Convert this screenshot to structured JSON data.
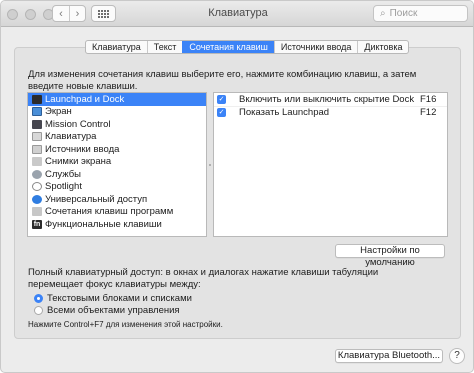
{
  "window": {
    "title": "Клавиатура"
  },
  "toolbar": {
    "back": "‹",
    "forward": "›",
    "search_placeholder": "Поиск",
    "search_icon": "search-icon"
  },
  "tabs": [
    {
      "label": "Клавиатура",
      "active": false
    },
    {
      "label": "Текст",
      "active": false
    },
    {
      "label": "Сочетания клавиш",
      "active": true
    },
    {
      "label": "Источники ввода",
      "active": false
    },
    {
      "label": "Диктовка",
      "active": false
    }
  ],
  "instructions": "Для изменения сочетания клавиш выберите его, нажмите комбинацию клавиш, а затем введите новые клавиши.",
  "categories": [
    {
      "label": "Launchpad и Dock",
      "icon": "dock-icon",
      "selected": true
    },
    {
      "label": "Экран",
      "icon": "display-icon",
      "selected": false
    },
    {
      "label": "Mission Control",
      "icon": "mission-control-icon",
      "selected": false
    },
    {
      "label": "Клавиатура",
      "icon": "keyboard-icon",
      "selected": false
    },
    {
      "label": "Источники ввода",
      "icon": "input-sources-icon",
      "selected": false
    },
    {
      "label": "Снимки экрана",
      "icon": "screenshot-icon",
      "selected": false
    },
    {
      "label": "Службы",
      "icon": "services-gear-icon",
      "selected": false
    },
    {
      "label": "Spotlight",
      "icon": "spotlight-icon",
      "selected": false
    },
    {
      "label": "Универсальный доступ",
      "icon": "accessibility-icon",
      "selected": false
    },
    {
      "label": "Сочетания клавиш программ",
      "icon": "app-shortcuts-icon",
      "selected": false
    },
    {
      "label": "Функциональные клавиши",
      "icon": "fn-key-icon",
      "selected": false
    }
  ],
  "shortcuts": [
    {
      "label": "Включить или выключить скрытие Dock",
      "key": "F16",
      "checked": true
    },
    {
      "label": "Показать Launchpad",
      "key": "F12",
      "checked": true
    }
  ],
  "buttons": {
    "defaults": "Настройки по умолчанию",
    "bluetooth": "Клавиатура Bluetooth...",
    "help": "?"
  },
  "keyboard_access": {
    "text": "Полный клавиатурный доступ: в окнах и диалогах нажатие клавиши табуляции перемещает фокус клавиатуры между:",
    "options": [
      {
        "label": "Текстовыми блоками и списками",
        "selected": true
      },
      {
        "label": "Всеми объектами управления",
        "selected": false
      }
    ],
    "hint": "Нажмите Control+F7 для изменения этой настройки."
  },
  "colors": {
    "accent": "#3b83f7",
    "window_bg": "#ececec"
  }
}
